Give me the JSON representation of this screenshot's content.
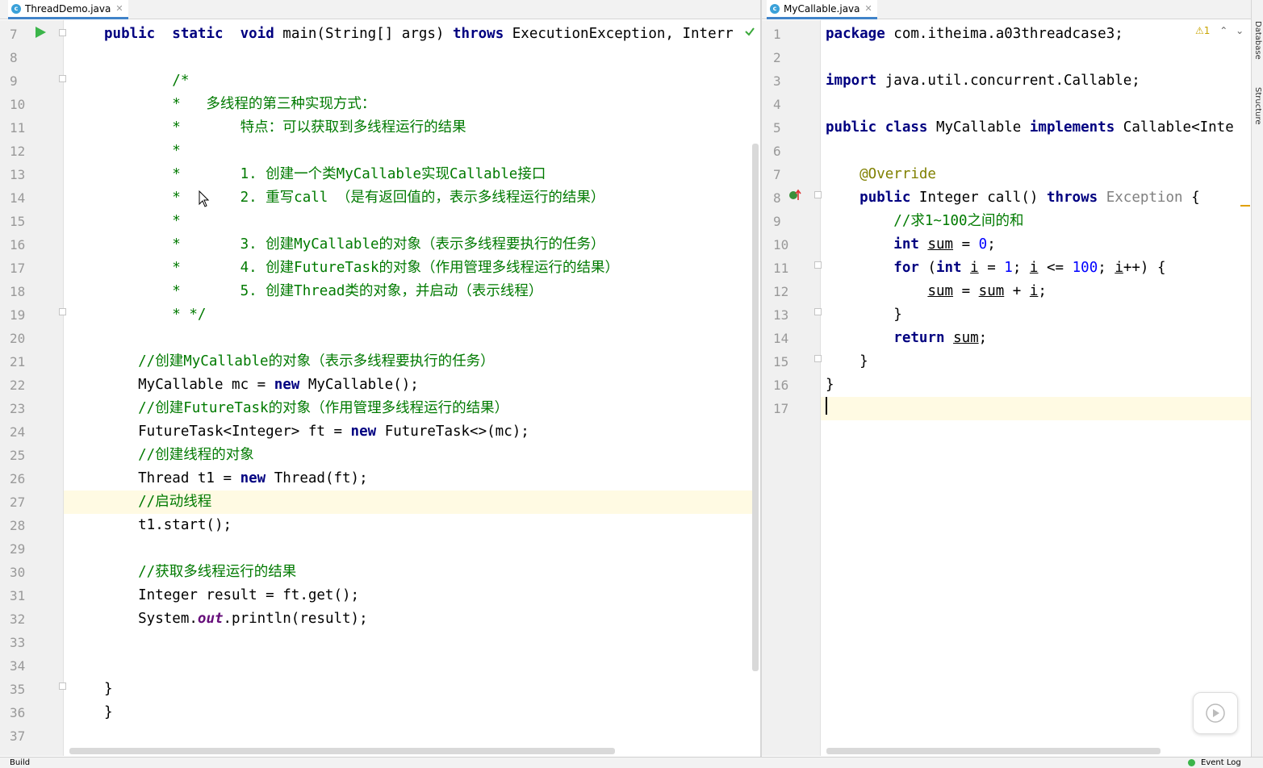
{
  "tabs": {
    "left": {
      "label": "ThreadDemo.java",
      "icon": "c"
    },
    "right": {
      "label": "MyCallable.java",
      "icon": "c"
    }
  },
  "left_editor": {
    "lines": [
      {
        "n": "7",
        "t": [
          [
            "kw",
            "public"
          ],
          [
            "",
            "  "
          ],
          [
            "kw",
            "static"
          ],
          [
            "",
            "  "
          ],
          [
            "kw",
            "void"
          ],
          [
            "",
            " main(String[] args) "
          ],
          [
            "kw",
            "throws"
          ],
          [
            "",
            " ExecutionException, Interr"
          ]
        ]
      },
      {
        "n": "8",
        "t": []
      },
      {
        "n": "9",
        "t": [
          [
            "cm",
            "        /*"
          ]
        ]
      },
      {
        "n": "10",
        "t": [
          [
            "cm",
            "        *   多线程的第三种实现方式："
          ]
        ]
      },
      {
        "n": "11",
        "t": [
          [
            "cm",
            "        *       特点：可以获取到多线程运行的结果"
          ]
        ]
      },
      {
        "n": "12",
        "t": [
          [
            "cm",
            "        *"
          ]
        ]
      },
      {
        "n": "13",
        "t": [
          [
            "cm",
            "        *       1. 创建一个类MyCallable实现Callable接口"
          ]
        ]
      },
      {
        "n": "14",
        "t": [
          [
            "cm",
            "        *       2. 重写call （是有返回值的，表示多线程运行的结果）"
          ]
        ]
      },
      {
        "n": "15",
        "t": [
          [
            "cm",
            "        *"
          ]
        ]
      },
      {
        "n": "16",
        "t": [
          [
            "cm",
            "        *       3. 创建MyCallable的对象（表示多线程要执行的任务）"
          ]
        ]
      },
      {
        "n": "17",
        "t": [
          [
            "cm",
            "        *       4. 创建FutureTask的对象（作用管理多线程运行的结果）"
          ]
        ]
      },
      {
        "n": "18",
        "t": [
          [
            "cm",
            "        *       5. 创建Thread类的对象，并启动（表示线程）"
          ]
        ]
      },
      {
        "n": "19",
        "t": [
          [
            "cm",
            "        * */"
          ]
        ]
      },
      {
        "n": "20",
        "t": []
      },
      {
        "n": "21",
        "t": [
          [
            "cm",
            "    //创建MyCallable的对象（表示多线程要执行的任务）"
          ]
        ]
      },
      {
        "n": "22",
        "t": [
          [
            "",
            "    MyCallable mc = "
          ],
          [
            "kw",
            "new"
          ],
          [
            "",
            " MyCallable();"
          ]
        ]
      },
      {
        "n": "23",
        "t": [
          [
            "cm",
            "    //创建FutureTask的对象（作用管理多线程运行的结果）"
          ]
        ]
      },
      {
        "n": "24",
        "t": [
          [
            "",
            "    FutureTask<Integer> ft = "
          ],
          [
            "kw",
            "new"
          ],
          [
            "",
            " FutureTask<>(mc);"
          ]
        ]
      },
      {
        "n": "25",
        "t": [
          [
            "cm",
            "    //创建线程的对象"
          ]
        ]
      },
      {
        "n": "26",
        "t": [
          [
            "",
            "    Thread t1 = "
          ],
          [
            "kw",
            "new"
          ],
          [
            "",
            " Thread(ft);"
          ]
        ]
      },
      {
        "n": "27",
        "t": [
          [
            "cm",
            "    //启动线程"
          ]
        ]
      },
      {
        "n": "28",
        "t": [
          [
            "",
            "    t1.start();"
          ]
        ]
      },
      {
        "n": "29",
        "t": []
      },
      {
        "n": "30",
        "t": [
          [
            "cm",
            "    //获取多线程运行的结果"
          ]
        ]
      },
      {
        "n": "31",
        "t": [
          [
            "",
            "    Integer result = ft.get();"
          ]
        ]
      },
      {
        "n": "32",
        "t": [
          [
            "",
            "    System."
          ],
          [
            "fld",
            "out"
          ],
          [
            "",
            ".println(result);"
          ]
        ]
      },
      {
        "n": "33",
        "t": []
      },
      {
        "n": "34",
        "t": []
      },
      {
        "n": "35",
        "t": [
          [
            "",
            "}"
          ]
        ]
      },
      {
        "n": "36",
        "t": [
          [
            "",
            "}"
          ]
        ]
      },
      {
        "n": "37",
        "t": []
      }
    ]
  },
  "right_editor": {
    "lines": [
      {
        "n": "1",
        "t": [
          [
            "kw",
            "package"
          ],
          [
            "",
            " com.itheima.a03threadcase3;"
          ]
        ]
      },
      {
        "n": "2",
        "t": []
      },
      {
        "n": "3",
        "t": [
          [
            "kw",
            "import"
          ],
          [
            "",
            " java.util.concurrent.Callable;"
          ]
        ]
      },
      {
        "n": "4",
        "t": []
      },
      {
        "n": "5",
        "t": [
          [
            "kw",
            "public"
          ],
          [
            "",
            " "
          ],
          [
            "kw",
            "class"
          ],
          [
            "",
            " MyCallable "
          ],
          [
            "kw",
            "implements"
          ],
          [
            "",
            " Callable<Inte"
          ]
        ]
      },
      {
        "n": "6",
        "t": []
      },
      {
        "n": "7",
        "t": [
          [
            "ann",
            "    @Override"
          ]
        ]
      },
      {
        "n": "8",
        "t": [
          [
            "",
            "    "
          ],
          [
            "kw",
            "public"
          ],
          [
            "",
            " Integer call() "
          ],
          [
            "kw",
            "throws"
          ],
          [
            "",
            " "
          ],
          [
            "gr",
            "Exception"
          ],
          [
            "",
            " {"
          ]
        ]
      },
      {
        "n": "9",
        "t": [
          [
            "cm",
            "        //求1~100之间的和"
          ]
        ]
      },
      {
        "n": "10",
        "t": [
          [
            "",
            "        "
          ],
          [
            "kw",
            "int"
          ],
          [
            "",
            " "
          ],
          [
            "ul",
            "sum"
          ],
          [
            "",
            " = "
          ],
          [
            "num",
            "0"
          ],
          [
            "",
            ";"
          ]
        ]
      },
      {
        "n": "11",
        "t": [
          [
            "",
            "        "
          ],
          [
            "kw",
            "for"
          ],
          [
            "",
            " ("
          ],
          [
            "kw",
            "int"
          ],
          [
            "",
            " "
          ],
          [
            "ul",
            "i"
          ],
          [
            "",
            " = "
          ],
          [
            "num",
            "1"
          ],
          [
            "",
            "; "
          ],
          [
            "ul",
            "i"
          ],
          [
            "",
            " <= "
          ],
          [
            "num",
            "100"
          ],
          [
            "",
            "; "
          ],
          [
            "ul",
            "i"
          ],
          [
            "",
            "++) {"
          ]
        ]
      },
      {
        "n": "12",
        "t": [
          [
            "",
            "            "
          ],
          [
            "ul",
            "sum"
          ],
          [
            "",
            " = "
          ],
          [
            "ul",
            "sum"
          ],
          [
            "",
            " + "
          ],
          [
            "ul",
            "i"
          ],
          [
            "",
            ";"
          ]
        ]
      },
      {
        "n": "13",
        "t": [
          [
            "",
            "        }"
          ]
        ]
      },
      {
        "n": "14",
        "t": [
          [
            "",
            "        "
          ],
          [
            "kw",
            "return"
          ],
          [
            "",
            " "
          ],
          [
            "ul",
            "sum"
          ],
          [
            "",
            ";"
          ]
        ]
      },
      {
        "n": "15",
        "t": [
          [
            "",
            "    }"
          ]
        ]
      },
      {
        "n": "16",
        "t": [
          [
            "",
            "}"
          ]
        ]
      },
      {
        "n": "17",
        "t": []
      }
    ]
  },
  "right_panel": {
    "database_label": "Database",
    "structure_label": "Structure"
  },
  "warnings": {
    "count": "1"
  },
  "status_bar": {
    "build_label": "Build",
    "event_log_label": "Event Log"
  },
  "colors": {
    "keyword": "#000080",
    "comment": "#007a00",
    "number": "#0000ff",
    "annotation": "#808000",
    "current_line": "#fffae3"
  }
}
